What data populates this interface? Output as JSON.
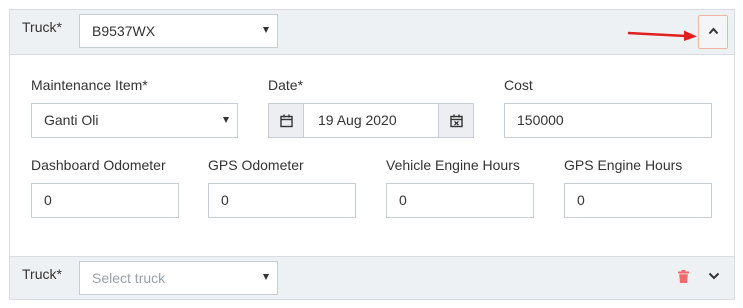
{
  "entry1": {
    "truck_label": "Truck*",
    "truck_value": "B9537WX",
    "maintenance_item_label": "Maintenance Item*",
    "maintenance_item_value": "Ganti Oli",
    "date_label": "Date*",
    "date_value": "19 Aug 2020",
    "cost_label": "Cost",
    "cost_value": "150000",
    "dashboard_odometer_label": "Dashboard Odometer",
    "dashboard_odometer_value": "0",
    "gps_odometer_label": "GPS Odometer",
    "gps_odometer_value": "0",
    "vehicle_engine_hours_label": "Vehicle Engine Hours",
    "vehicle_engine_hours_value": "0",
    "gps_engine_hours_label": "GPS Engine Hours",
    "gps_engine_hours_value": "0"
  },
  "entry2": {
    "truck_label": "Truck*",
    "truck_placeholder": "Select truck"
  },
  "colors": {
    "header_bg": "#eef1f4",
    "border": "#c8cdd3",
    "annotation_arrow": "#e02020",
    "delete_icon": "#f06b6b"
  },
  "icons": [
    "chevron-up-icon",
    "arrow-annotation-icon",
    "calendar-icon",
    "calendar-clear-icon",
    "trash-icon",
    "chevron-down-icon",
    "caret-down-icon"
  ]
}
